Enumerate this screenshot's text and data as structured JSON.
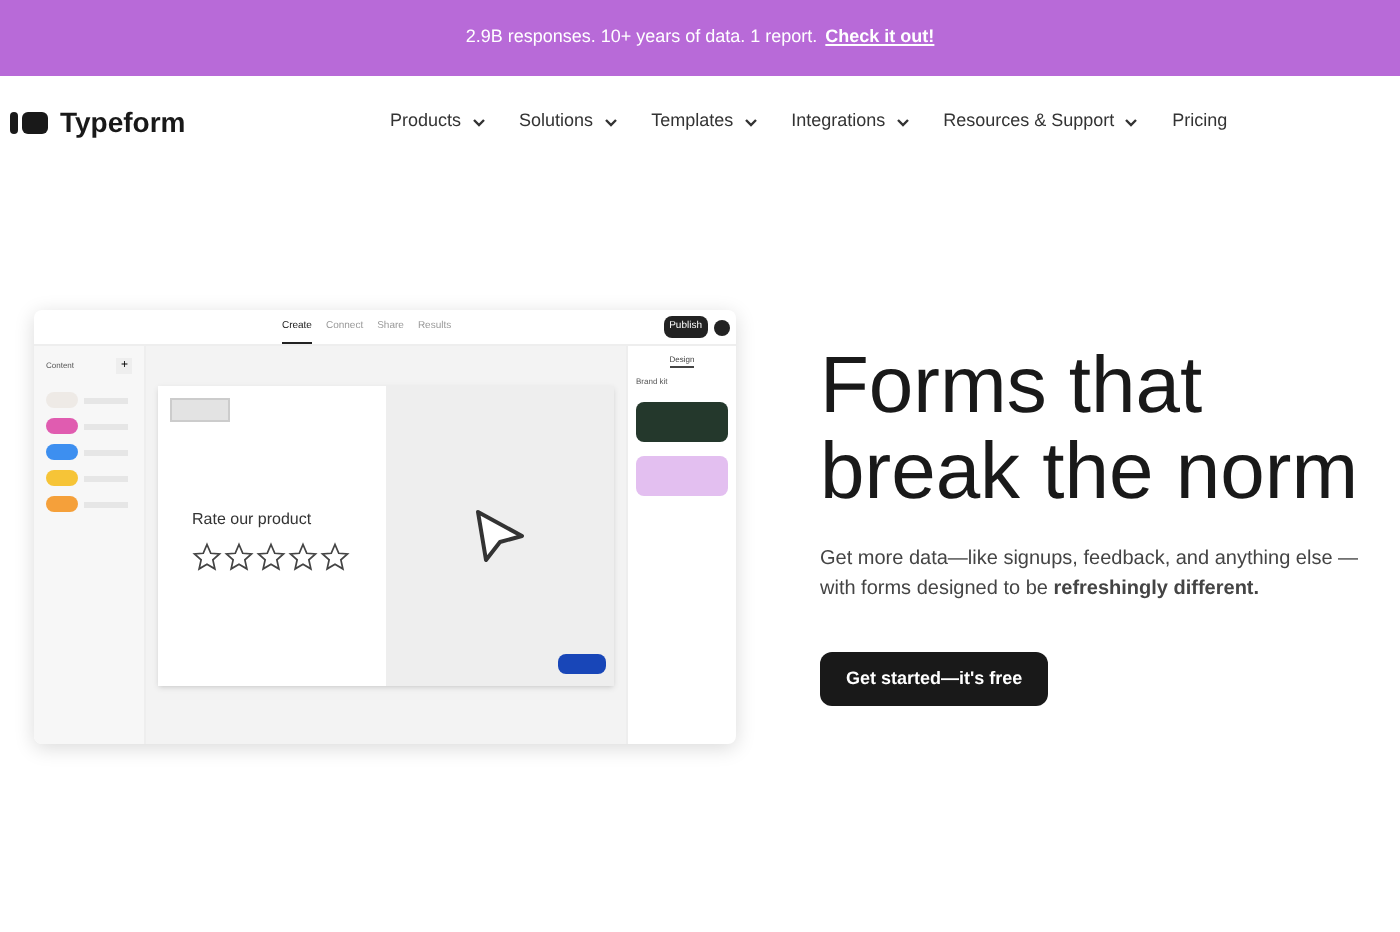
{
  "banner": {
    "text": "2.9B responses. 10+ years of data. 1 report.",
    "link": "Check it out!"
  },
  "logo": {
    "text": "Typeform"
  },
  "nav": [
    {
      "label": "Products",
      "dropdown": true
    },
    {
      "label": "Solutions",
      "dropdown": true
    },
    {
      "label": "Templates",
      "dropdown": true
    },
    {
      "label": "Integrations",
      "dropdown": true
    },
    {
      "label": "Resources & Support",
      "dropdown": true
    },
    {
      "label": "Pricing",
      "dropdown": false
    }
  ],
  "editor": {
    "tabs": [
      {
        "label": "Create",
        "selected": true
      },
      {
        "label": "Connect",
        "selected": false
      },
      {
        "label": "Share",
        "selected": false
      },
      {
        "label": "Results",
        "selected": false
      }
    ],
    "publish": "Publish",
    "sidebar": {
      "title": "Content",
      "add": "+",
      "items": [
        {
          "color": "#eeeae6"
        },
        {
          "color": "#e05cb0"
        },
        {
          "color": "#3d8ff0"
        },
        {
          "color": "#f6c437"
        },
        {
          "color": "#f5a03a"
        }
      ]
    },
    "question": "Rate our product",
    "stars": 0,
    "panel": {
      "tab": "Design",
      "heading": "Brand kit",
      "themes": [
        {
          "color": "#24382c"
        },
        {
          "color": "#e3bff0"
        }
      ]
    }
  },
  "hero": {
    "title_lines": [
      "Forms that",
      "break the norm"
    ],
    "text": "Get more data—like signups, feedback, and anything else —with forms designed to be **refreshingly different.**",
    "cta": "Get started—it's free"
  }
}
